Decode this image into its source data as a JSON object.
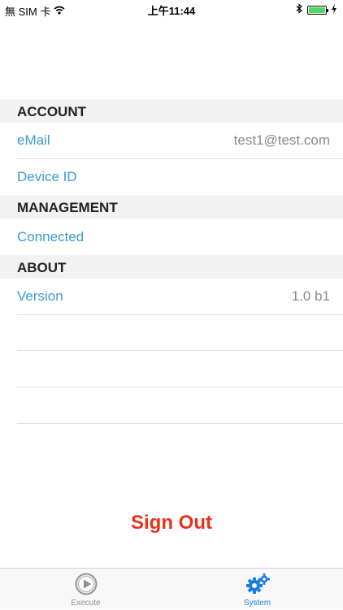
{
  "status_bar": {
    "carrier": "無 SIM 卡",
    "time": "上午11:44"
  },
  "account": {
    "header": "ACCOUNT",
    "email_label": "eMail",
    "email_value": "test1@test.com",
    "device_id_label": "Device ID"
  },
  "management": {
    "header": "MANAGEMENT",
    "connected_label": "Connected"
  },
  "about": {
    "header": "ABOUT",
    "version_label": "Version",
    "version_value": "1.0 b1"
  },
  "actions": {
    "sign_out_label": "Sign Out"
  },
  "tab_bar": {
    "tabs": [
      {
        "label": "Execute",
        "icon": "play-circle-icon",
        "active": false
      },
      {
        "label": "System",
        "icon": "gears-icon",
        "active": true
      }
    ]
  },
  "colors": {
    "accent": "#3b9dcc",
    "tab_active": "#1a7fe0",
    "tab_inactive": "#8e8e8e",
    "destructive": "#e8311c",
    "section_bg": "#f2f2f2",
    "battery": "#4cd964"
  }
}
